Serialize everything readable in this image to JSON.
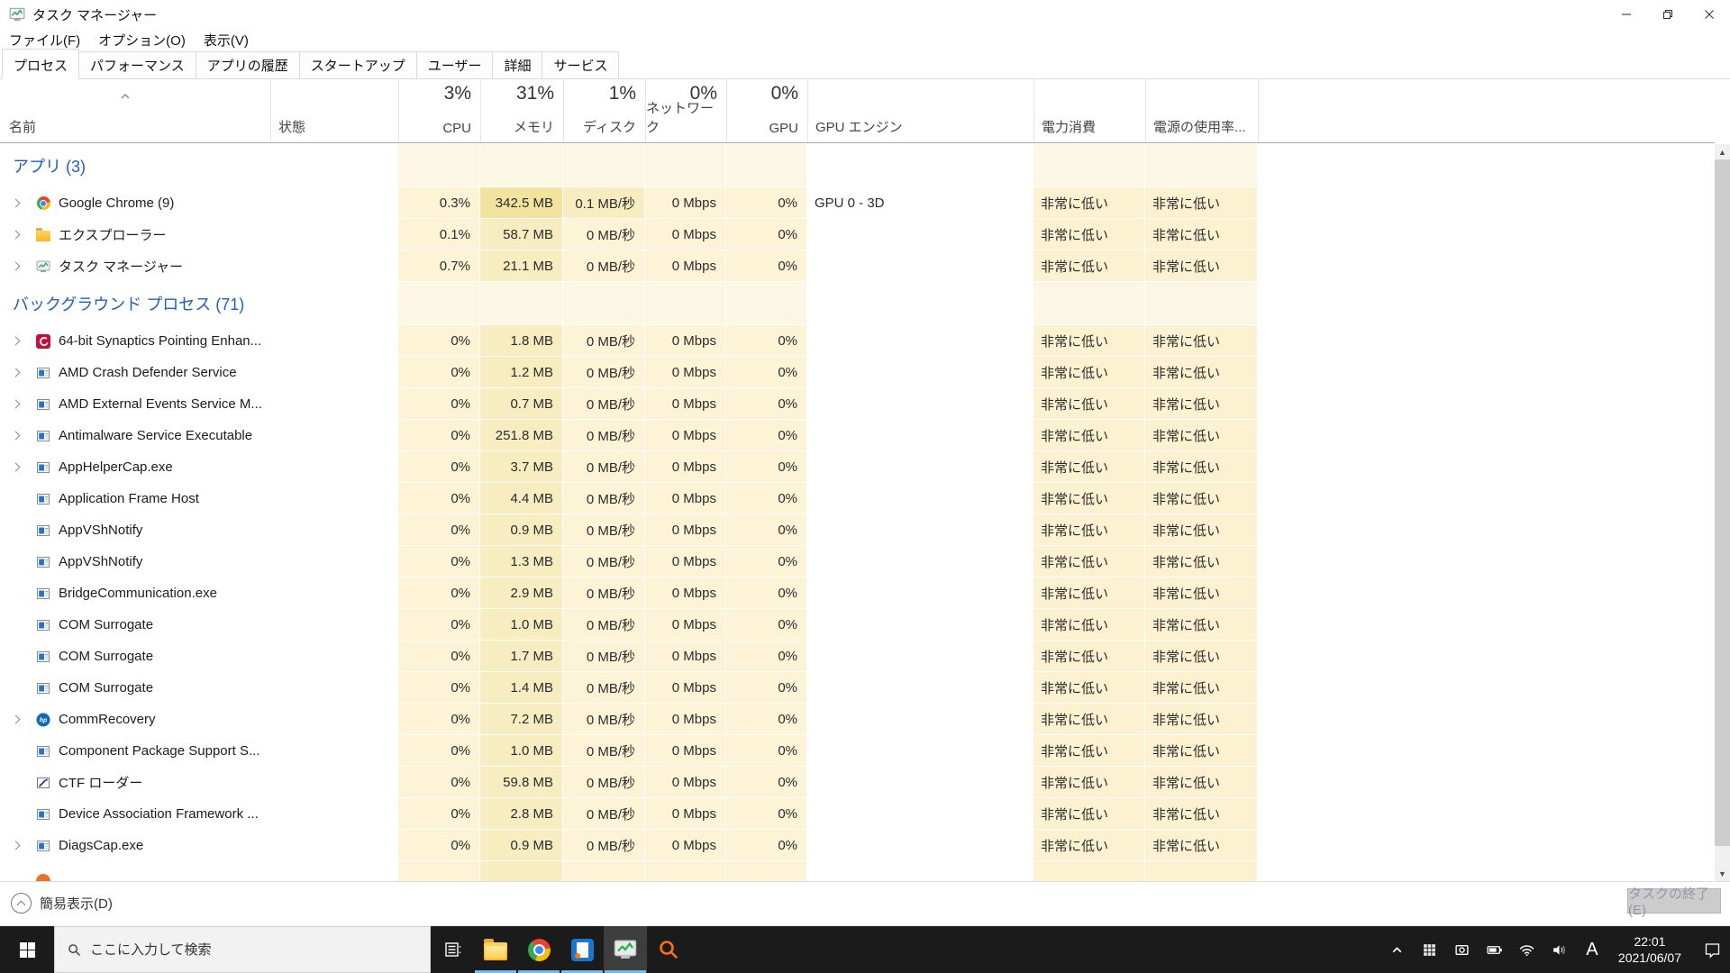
{
  "window": {
    "title": "タスク マネージャー",
    "menu": [
      "ファイル(F)",
      "オプション(O)",
      "表示(V)"
    ]
  },
  "tabs": [
    {
      "label": "プロセス",
      "active": true
    },
    {
      "label": "パフォーマンス",
      "active": false
    },
    {
      "label": "アプリの履歴",
      "active": false
    },
    {
      "label": "スタートアップ",
      "active": false
    },
    {
      "label": "ユーザー",
      "active": false
    },
    {
      "label": "詳細",
      "active": false
    },
    {
      "label": "サービス",
      "active": false
    }
  ],
  "table": {
    "columns": {
      "name": {
        "label": "名前"
      },
      "status": {
        "label": "状態"
      },
      "cpu": {
        "label": "CPU",
        "total": "3%"
      },
      "memory": {
        "label": "メモリ",
        "total": "31%"
      },
      "disk": {
        "label": "ディスク",
        "total": "1%"
      },
      "network": {
        "label": "ネットワーク",
        "total": "0%"
      },
      "gpu": {
        "label": "GPU",
        "total": "0%"
      },
      "gpu_engine": {
        "label": "GPU エンジン"
      },
      "power": {
        "label": "電力消費"
      },
      "power_trend": {
        "label": "電源の使用率..."
      }
    },
    "rows": [
      {
        "type": "group",
        "label": "アプリ (3)"
      },
      {
        "type": "proc",
        "icon": "chrome",
        "expand": true,
        "name": "Google Chrome (9)",
        "cpu": "0.3%",
        "mem": "342.5 MB",
        "disk": "0.1 MB/秒",
        "net": "0 Mbps",
        "gpu": "0%",
        "engine": "GPU 0 - 3D",
        "power": "非常に低い",
        "trend": "非常に低い",
        "memHot": true,
        "diskHot": true
      },
      {
        "type": "proc",
        "icon": "folder",
        "expand": true,
        "name": "エクスプローラー",
        "cpu": "0.1%",
        "mem": "58.7 MB",
        "disk": "0 MB/秒",
        "net": "0 Mbps",
        "gpu": "0%",
        "engine": "",
        "power": "非常に低い",
        "trend": "非常に低い"
      },
      {
        "type": "proc",
        "icon": "taskmgr",
        "expand": true,
        "name": "タスク マネージャー",
        "cpu": "0.7%",
        "mem": "21.1 MB",
        "disk": "0 MB/秒",
        "net": "0 Mbps",
        "gpu": "0%",
        "engine": "",
        "power": "非常に低い",
        "trend": "非常に低い"
      },
      {
        "type": "group",
        "label": "バックグラウンド プロセス (71)"
      },
      {
        "type": "proc",
        "icon": "synaptics",
        "expand": true,
        "name": "64-bit Synaptics Pointing Enhan...",
        "cpu": "0%",
        "mem": "1.8 MB",
        "disk": "0 MB/秒",
        "net": "0 Mbps",
        "gpu": "0%",
        "engine": "",
        "power": "非常に低い",
        "trend": "非常に低い"
      },
      {
        "type": "proc",
        "icon": "winapp",
        "expand": true,
        "name": "AMD Crash Defender Service",
        "cpu": "0%",
        "mem": "1.2 MB",
        "disk": "0 MB/秒",
        "net": "0 Mbps",
        "gpu": "0%",
        "engine": "",
        "power": "非常に低い",
        "trend": "非常に低い"
      },
      {
        "type": "proc",
        "icon": "winapp",
        "expand": true,
        "name": "AMD External Events Service M...",
        "cpu": "0%",
        "mem": "0.7 MB",
        "disk": "0 MB/秒",
        "net": "0 Mbps",
        "gpu": "0%",
        "engine": "",
        "power": "非常に低い",
        "trend": "非常に低い"
      },
      {
        "type": "proc",
        "icon": "winapp",
        "expand": true,
        "name": "Antimalware Service Executable",
        "cpu": "0%",
        "mem": "251.8 MB",
        "disk": "0 MB/秒",
        "net": "0 Mbps",
        "gpu": "0%",
        "engine": "",
        "power": "非常に低い",
        "trend": "非常に低い"
      },
      {
        "type": "proc",
        "icon": "winapp",
        "expand": true,
        "name": "AppHelperCap.exe",
        "cpu": "0%",
        "mem": "3.7 MB",
        "disk": "0 MB/秒",
        "net": "0 Mbps",
        "gpu": "0%",
        "engine": "",
        "power": "非常に低い",
        "trend": "非常に低い"
      },
      {
        "type": "proc",
        "icon": "winapp",
        "expand": false,
        "name": "Application Frame Host",
        "cpu": "0%",
        "mem": "4.4 MB",
        "disk": "0 MB/秒",
        "net": "0 Mbps",
        "gpu": "0%",
        "engine": "",
        "power": "非常に低い",
        "trend": "非常に低い"
      },
      {
        "type": "proc",
        "icon": "winapp",
        "expand": false,
        "name": "AppVShNotify",
        "cpu": "0%",
        "mem": "0.9 MB",
        "disk": "0 MB/秒",
        "net": "0 Mbps",
        "gpu": "0%",
        "engine": "",
        "power": "非常に低い",
        "trend": "非常に低い"
      },
      {
        "type": "proc",
        "icon": "winapp",
        "expand": false,
        "name": "AppVShNotify",
        "cpu": "0%",
        "mem": "1.3 MB",
        "disk": "0 MB/秒",
        "net": "0 Mbps",
        "gpu": "0%",
        "engine": "",
        "power": "非常に低い",
        "trend": "非常に低い"
      },
      {
        "type": "proc",
        "icon": "winapp",
        "expand": false,
        "name": "BridgeCommunication.exe",
        "cpu": "0%",
        "mem": "2.9 MB",
        "disk": "0 MB/秒",
        "net": "0 Mbps",
        "gpu": "0%",
        "engine": "",
        "power": "非常に低い",
        "trend": "非常に低い"
      },
      {
        "type": "proc",
        "icon": "winapp",
        "expand": false,
        "name": "COM Surrogate",
        "cpu": "0%",
        "mem": "1.0 MB",
        "disk": "0 MB/秒",
        "net": "0 Mbps",
        "gpu": "0%",
        "engine": "",
        "power": "非常に低い",
        "trend": "非常に低い"
      },
      {
        "type": "proc",
        "icon": "winapp",
        "expand": false,
        "name": "COM Surrogate",
        "cpu": "0%",
        "mem": "1.7 MB",
        "disk": "0 MB/秒",
        "net": "0 Mbps",
        "gpu": "0%",
        "engine": "",
        "power": "非常に低い",
        "trend": "非常に低い"
      },
      {
        "type": "proc",
        "icon": "winapp",
        "expand": false,
        "name": "COM Surrogate",
        "cpu": "0%",
        "mem": "1.4 MB",
        "disk": "0 MB/秒",
        "net": "0 Mbps",
        "gpu": "0%",
        "engine": "",
        "power": "非常に低い",
        "trend": "非常に低い"
      },
      {
        "type": "proc",
        "icon": "hp",
        "expand": true,
        "name": "CommRecovery",
        "cpu": "0%",
        "mem": "7.2 MB",
        "disk": "0 MB/秒",
        "net": "0 Mbps",
        "gpu": "0%",
        "engine": "",
        "power": "非常に低い",
        "trend": "非常に低い"
      },
      {
        "type": "proc",
        "icon": "winapp",
        "expand": false,
        "name": "Component Package Support S...",
        "cpu": "0%",
        "mem": "1.0 MB",
        "disk": "0 MB/秒",
        "net": "0 Mbps",
        "gpu": "0%",
        "engine": "",
        "power": "非常に低い",
        "trend": "非常に低い"
      },
      {
        "type": "proc",
        "icon": "ctf",
        "expand": false,
        "name": "CTF ローダー",
        "cpu": "0%",
        "mem": "59.8 MB",
        "disk": "0 MB/秒",
        "net": "0 Mbps",
        "gpu": "0%",
        "engine": "",
        "power": "非常に低い",
        "trend": "非常に低い"
      },
      {
        "type": "proc",
        "icon": "winapp",
        "expand": false,
        "name": "Device Association Framework ...",
        "cpu": "0%",
        "mem": "2.8 MB",
        "disk": "0 MB/秒",
        "net": "0 Mbps",
        "gpu": "0%",
        "engine": "",
        "power": "非常に低い",
        "trend": "非常に低い"
      },
      {
        "type": "proc",
        "icon": "winapp",
        "expand": true,
        "name": "DiagsCap.exe",
        "cpu": "0%",
        "mem": "0.9 MB",
        "disk": "0 MB/秒",
        "net": "0 Mbps",
        "gpu": "0%",
        "engine": "",
        "power": "非常に低い",
        "trend": "非常に低い"
      },
      {
        "type": "partial"
      }
    ]
  },
  "footer": {
    "simple_view": "簡易表示(D)",
    "end_task": "タスクの終了(E)"
  },
  "taskbar": {
    "search_placeholder": "ここに入力して検索",
    "tray": {
      "ime": "A",
      "time": "22:01",
      "date": "2021/06/07"
    }
  },
  "colors": {
    "accent_blue": "#1f5fbe",
    "heat_base": "#fdf4d7",
    "heat_group": "#fcf6e4",
    "heat_memory": "#f7edc0",
    "heat_memory_hot": "#f2e39e",
    "heat_disk_hot": "#f8edc0",
    "heat_power": "#fcf2d1",
    "taskbar_underline": "#76b9ed",
    "end_task_text": "#8e9aa9"
  }
}
